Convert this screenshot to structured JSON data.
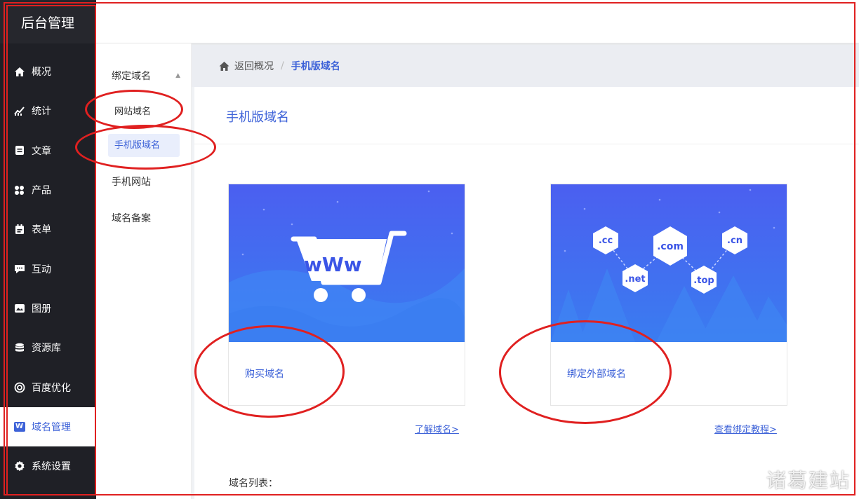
{
  "brand": {
    "title": "后台管理"
  },
  "nav": [
    {
      "label": "概况",
      "icon": "home-icon"
    },
    {
      "label": "统计",
      "icon": "chart-icon"
    },
    {
      "label": "文章",
      "icon": "article-icon"
    },
    {
      "label": "产品",
      "icon": "product-icon"
    },
    {
      "label": "表单",
      "icon": "form-icon"
    },
    {
      "label": "互动",
      "icon": "chat-icon"
    },
    {
      "label": "图册",
      "icon": "gallery-icon"
    },
    {
      "label": "资源库",
      "icon": "database-icon"
    },
    {
      "label": "百度优化",
      "icon": "target-icon"
    },
    {
      "label": "域名管理",
      "icon": "domain-icon",
      "badge": "W",
      "active": true
    },
    {
      "label": "系统设置",
      "icon": "gear-icon"
    }
  ],
  "submenu": {
    "group": "绑定域名",
    "items": [
      "网站域名",
      "手机版域名",
      "手机网站",
      "域名备案"
    ],
    "selected": "手机版域名"
  },
  "breadcrumb": {
    "back": "返回概况",
    "separator": "/",
    "current": "手机版域名"
  },
  "main": {
    "title": "手机版域名",
    "card_buy": {
      "label": "购买域名",
      "cart_text": "wWw"
    },
    "card_bind": {
      "label": "绑定外部域名",
      "tlds": [
        ".cc",
        ".com",
        ".cn",
        ".net",
        ".top"
      ]
    },
    "link_learn": "了解域名>",
    "link_tutorial": "查看绑定教程>",
    "list_title": "域名列表："
  },
  "watermark": "诸葛建站",
  "colors": {
    "accent": "#3d62d8",
    "sidebar": "#1f2026",
    "annotation": "#e02020"
  }
}
